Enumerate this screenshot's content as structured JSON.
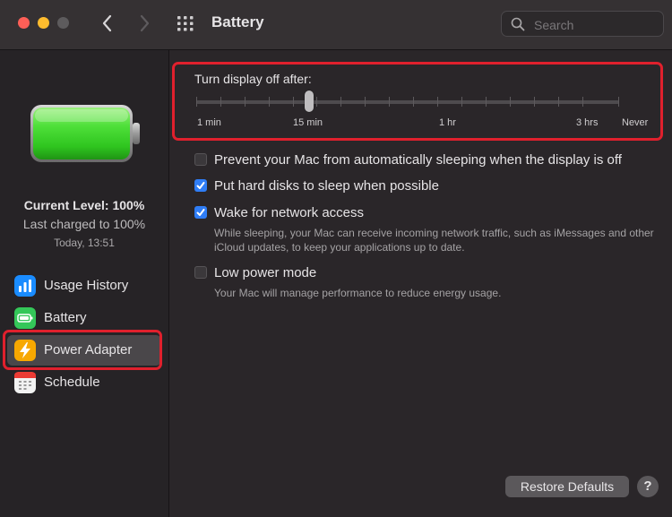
{
  "window": {
    "title": "Battery",
    "search_placeholder": "Search"
  },
  "sidebar": {
    "status": {
      "current_level": "Current Level: 100%",
      "last_charged": "Last charged to 100%",
      "timestamp": "Today, 13:51",
      "charge_fraction": 1.0
    },
    "items": [
      {
        "label": "Usage History",
        "icon": "bar-chart-icon",
        "color": "#1a8cff"
      },
      {
        "label": "Battery",
        "icon": "battery-icon",
        "color": "#34c759"
      },
      {
        "label": "Power Adapter",
        "icon": "bolt-icon",
        "color": "#f7a800"
      },
      {
        "label": "Schedule",
        "icon": "calendar-icon",
        "color": "#f2f2f2"
      }
    ],
    "selected_item": "Power Adapter"
  },
  "main": {
    "slider": {
      "title": "Turn display off after:",
      "tick_labels": [
        "1 min",
        "15 min",
        "1 hr",
        "3 hrs",
        "Never"
      ],
      "selected": "15 min"
    },
    "options": [
      {
        "label": "Prevent your Mac from automatically sleeping when the display is off",
        "checked": false
      },
      {
        "label": "Put hard disks to sleep when possible",
        "checked": true
      },
      {
        "label": "Wake for network access",
        "checked": true,
        "description": "While sleeping, your Mac can receive incoming network traffic, such as iMessages and other iCloud updates, to keep your applications up to date."
      },
      {
        "label": "Low power mode",
        "checked": false,
        "description": "Your Mac will manage performance to reduce energy usage."
      }
    ],
    "restore_label": "Restore Defaults",
    "help_label": "?"
  },
  "colors": {
    "highlight": "#e0202d",
    "accent": "#2f7df6",
    "battery_fill": "#3ddc2c"
  }
}
